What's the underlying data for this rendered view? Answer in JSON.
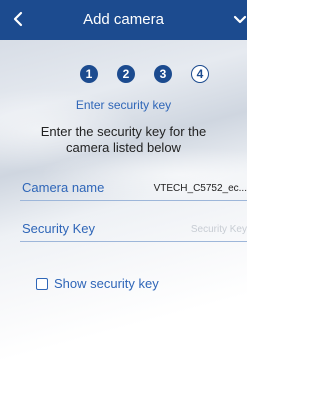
{
  "header": {
    "title": "Add camera",
    "back_icon": "chevron-left-icon",
    "next_icon": "chevron-down-icon",
    "color": "#1c4b8f"
  },
  "steps": {
    "items": [
      "1",
      "2",
      "3",
      "4"
    ],
    "current": 4
  },
  "subtitle": "Enter security key",
  "instructions": "Enter the security key for the camera listed below",
  "camera_name": {
    "label": "Camera name",
    "value": "VTECH_C5752_ec..."
  },
  "security_key": {
    "label": "Security Key",
    "placeholder": "Security Key",
    "value": ""
  },
  "show_key": {
    "label": "Show security key",
    "checked": false
  },
  "accent_color": "#2f66b8"
}
